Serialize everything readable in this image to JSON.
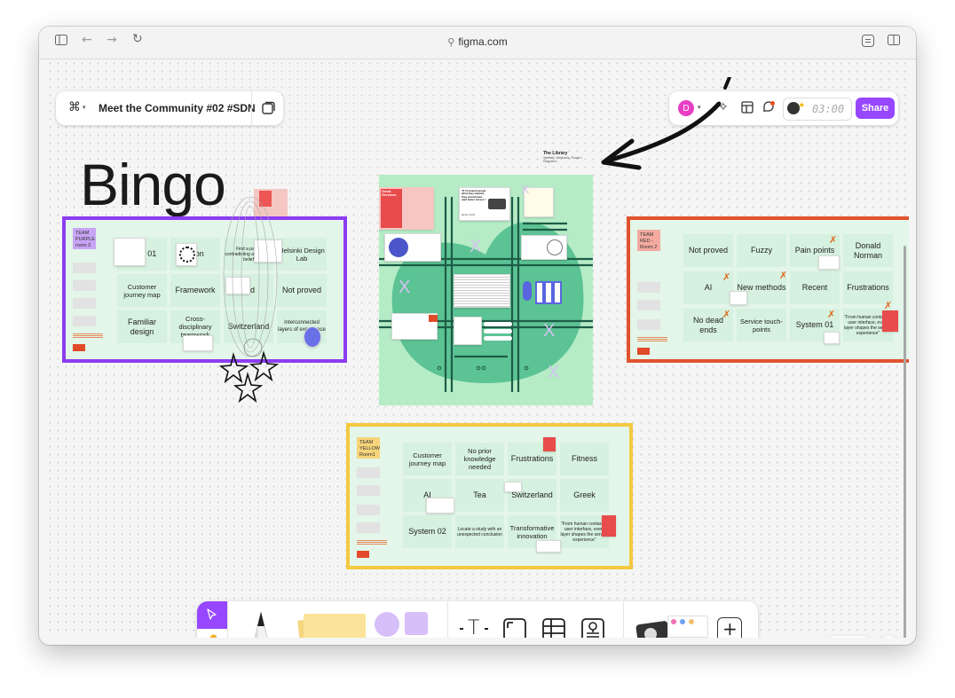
{
  "browser": {
    "url": "figma.com",
    "icons": [
      "sidebar-icon",
      "back-arrow-icon",
      "forward-arrow-icon",
      "reload-icon",
      "link-icon",
      "extensions-icon",
      "split-view-icon"
    ]
  },
  "figma_header": {
    "file_title": "Meet the Community #02 #SDN"
  },
  "toolbar_right": {
    "avatar_letter": "D",
    "avatar_color": "#e83ec3",
    "timer": "03:00",
    "share_label": "Share",
    "share_color": "#9747ff"
  },
  "canvas": {
    "bingo_title": "Bingo",
    "library_note": {
      "title": "The Library",
      "subtitle": "Artefakt / Abstracts / Books / Diagrams..."
    },
    "purple_board": {
      "color": "#8c3cf2",
      "team_label": "TEAM PURPLE room 3",
      "cells": [
        "...em 01",
        "...ion",
        "Find a paper contradicting a common belief",
        "Helsinki Design Lab",
        "Customer journey map",
        "Framework",
        "Old",
        "Not proved",
        "Familiar design",
        "Cross-disciplinary teamwork",
        "Switzerland",
        "Interconnected layers of experience"
      ]
    },
    "red_board": {
      "color": "#e0532f",
      "team_label": "TEAM RED - Room 2",
      "cells": [
        "Not proved",
        "Fuzzy",
        "Pain points",
        "Donald Norman",
        "AI",
        "New methods",
        "Recent",
        "Frustrations",
        "No dead ends",
        "Service touch-points",
        "System 01",
        "\"From human contact to user interface, every layer shapes the service experience\""
      ]
    },
    "yellow_board": {
      "color": "#f5c940",
      "team_label": "TEAM YELLOW Room1",
      "cells": [
        "Customer journey map",
        "No prior knowledge needed",
        "Frustrations",
        "Fitness",
        "AI",
        "Tea",
        "Switzerland",
        "Greek",
        "System 02",
        "Locate a study with an unexpected conclusion",
        "Transformative innovation",
        "\"From human contact to user interface, every layer shapes the service experience\""
      ]
    },
    "green_board": {
      "color": "#b5ecc6",
      "x_marks": [
        "X",
        "X",
        "X",
        "X",
        "X"
      ],
      "poster_title": "Good Services",
      "quote_title": "\"If I'd asked people what they wanted, they would have said faster horses.\"",
      "quote_author": "Henry Ford"
    }
  },
  "bottom_toolbar": {
    "tools": [
      "move-tool",
      "hand-tool",
      "pen-tool",
      "sticky-note-tool",
      "shape-tool",
      "text-tool",
      "section-tool",
      "table-tool",
      "stamp-tool",
      "widgets",
      "add"
    ],
    "text_glyph": "T"
  },
  "zoom_controls": {
    "minus": "−",
    "plus": "+",
    "help": "?"
  }
}
